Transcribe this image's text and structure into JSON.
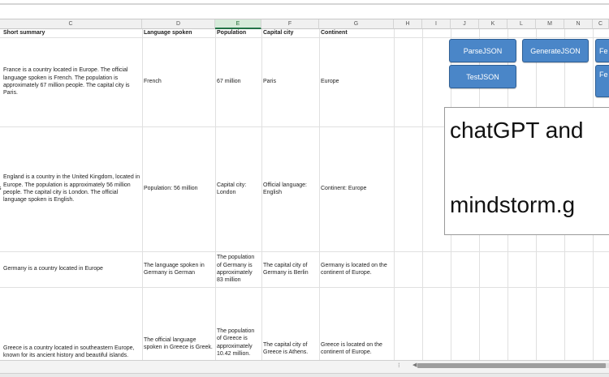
{
  "columns": [
    {
      "letter": "C",
      "selected": false
    },
    {
      "letter": "D",
      "selected": false
    },
    {
      "letter": "E",
      "selected": true
    },
    {
      "letter": "F",
      "selected": false
    },
    {
      "letter": "G",
      "selected": false
    },
    {
      "letter": "H",
      "selected": false
    },
    {
      "letter": "I",
      "selected": false
    },
    {
      "letter": "J",
      "selected": false
    },
    {
      "letter": "K",
      "selected": false
    },
    {
      "letter": "L",
      "selected": false
    },
    {
      "letter": "M",
      "selected": false
    },
    {
      "letter": "N",
      "selected": false
    },
    {
      "letter": "C",
      "selected": false
    }
  ],
  "headers": {
    "short_summary": "Short summary",
    "language": "Language spoken",
    "population": "Population",
    "capital": "Capital city",
    "continent": "Continent"
  },
  "rows": [
    {
      "summary": "France is a country located in Europe. The official language spoken is French. The population is approximately 67 million people. The capital city is Paris.",
      "language": "French",
      "population": "67 million",
      "capital": "Paris",
      "continent": "Europe"
    },
    {
      "left_fragment": "s",
      "summary": "England is a country in the United Kingdom, located in Europe. The population is approximately 56 million people. The capital city is London. The official language spoken is English.",
      "language": "Population: 56 million",
      "population": "Capital city: London",
      "capital": "Official language: English",
      "continent": "Continent: Europe"
    },
    {
      "summary": "Germany is a country located in Europe",
      "language": "The language spoken in Germany is German",
      "population": "The population of Germany is approximately 83 million",
      "capital": "The capital city of Germany is Berlin",
      "continent": "Germany is located on the continent of Europe."
    },
    {
      "summary": "Greece is a country located in southeastern Europe, known for its ancient history and beautiful islands.",
      "language": "The official language spoken in Greece is Greek.",
      "population": "The population of Greece is approximately 10.42 million.",
      "capital": "The capital city of Greece is Athens.",
      "continent": "Greece is located on the continent of Europe."
    }
  ],
  "macro_buttons": {
    "parse": "ParseJSON",
    "generate": "GenerateJSON",
    "test": "TestJSON",
    "partial1": "Fe",
    "partial2": "Fe"
  },
  "textbox": {
    "line1": "chatGPT and",
    "line2": "mindstorm.g"
  },
  "scrollbar": {
    "arrow": "◀",
    "grip": "⁝"
  }
}
